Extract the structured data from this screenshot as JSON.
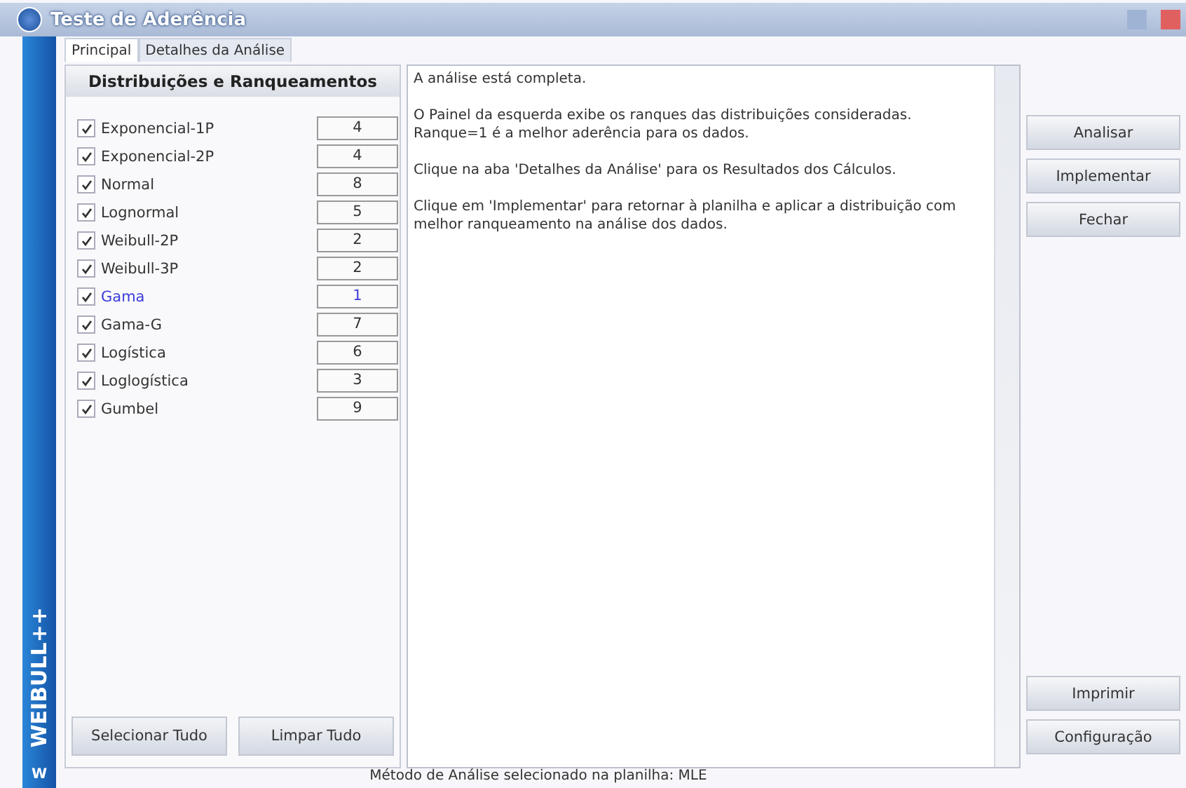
{
  "window": {
    "title": "Teste de Aderência"
  },
  "brand": {
    "name": "WEIBULL++",
    "badge": "W"
  },
  "tabs": [
    {
      "label": "Principal",
      "selected": true
    },
    {
      "label": "Detalhes da Análise",
      "selected": false
    }
  ],
  "distributions": {
    "header": "Distribuições e Ranqueamentos",
    "items": [
      {
        "name": "Exponencial-1P",
        "checked": true,
        "rank": "4",
        "highlighted": false
      },
      {
        "name": "Exponencial-2P",
        "checked": true,
        "rank": "4",
        "highlighted": false
      },
      {
        "name": "Normal",
        "checked": true,
        "rank": "8",
        "highlighted": false
      },
      {
        "name": "Lognormal",
        "checked": true,
        "rank": "5",
        "highlighted": false
      },
      {
        "name": "Weibull-2P",
        "checked": true,
        "rank": "2",
        "highlighted": false
      },
      {
        "name": "Weibull-3P",
        "checked": true,
        "rank": "2",
        "highlighted": false
      },
      {
        "name": "Gama",
        "checked": true,
        "rank": "1",
        "highlighted": true
      },
      {
        "name": "Gama-G",
        "checked": true,
        "rank": "7",
        "highlighted": false
      },
      {
        "name": "Logística",
        "checked": true,
        "rank": "6",
        "highlighted": false
      },
      {
        "name": "Loglogística",
        "checked": true,
        "rank": "3",
        "highlighted": false
      },
      {
        "name": "Gumbel",
        "checked": true,
        "rank": "9",
        "highlighted": false
      }
    ],
    "buttons": [
      "Selecionar Tudo",
      "Limpar Tudo"
    ]
  },
  "message": [
    "A análise está completa.",
    "O Painel da esquerda exibe os ranques das distribuições consideradas. Ranque=1 é a melhor aderência para os dados.",
    "Clique na aba 'Detalhes da Análise' para os Resultados dos Cálculos.",
    "Clique em 'Implementar' para retornar à planilha e aplicar a distribuição com melhor ranqueamento na análise dos dados."
  ],
  "actions_top": [
    "Analisar",
    "Implementar",
    "Fechar"
  ],
  "actions_bottom": [
    "Imprimir",
    "Configuração"
  ],
  "status_bar": "Método de Análise selecionado na planilha: MLE"
}
